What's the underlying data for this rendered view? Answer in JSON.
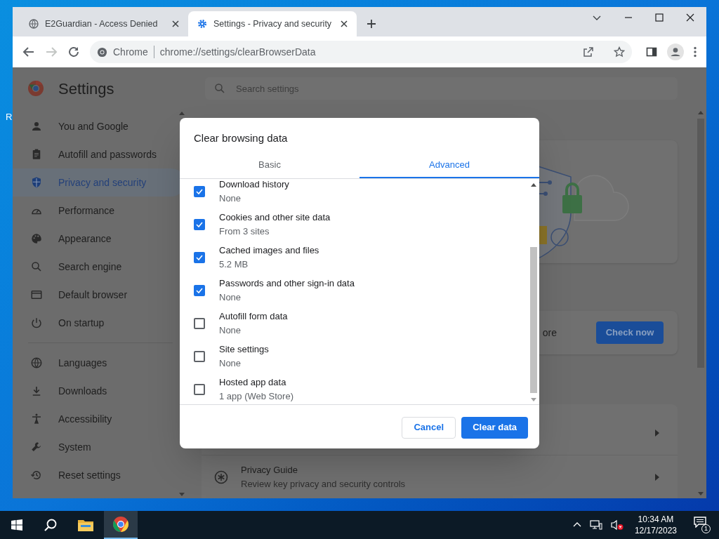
{
  "desktop": {
    "icon_label": "R"
  },
  "browser": {
    "tabs": [
      {
        "title": "E2Guardian - Access Denied",
        "selected": false
      },
      {
        "title": "Settings - Privacy and security",
        "selected": true
      }
    ],
    "forward_disabled": true,
    "omnibox": {
      "chip": "Chrome",
      "url": "chrome://settings/clearBrowserData"
    }
  },
  "settings": {
    "title": "Settings",
    "search": {
      "placeholder": "Search settings"
    },
    "nav_groups": [
      [
        {
          "label": "You and Google",
          "selected": false
        },
        {
          "label": "Autofill and passwords",
          "selected": false
        },
        {
          "label": "Privacy and security",
          "selected": true
        },
        {
          "label": "Performance",
          "selected": false
        },
        {
          "label": "Appearance",
          "selected": false
        },
        {
          "label": "Search engine",
          "selected": false
        },
        {
          "label": "Default browser",
          "selected": false
        },
        {
          "label": "On startup",
          "selected": false
        }
      ],
      [
        {
          "label": "Languages",
          "selected": false
        },
        {
          "label": "Downloads",
          "selected": false
        },
        {
          "label": "Accessibility",
          "selected": false
        },
        {
          "label": "System",
          "selected": false
        },
        {
          "label": "Reset settings",
          "selected": false
        }
      ]
    ],
    "safety_check": {
      "partial_text": "ore",
      "button": "Check now"
    },
    "rows": [
      {
        "kind": "covered"
      },
      {
        "kind": "item",
        "title": "Privacy Guide",
        "subtitle": "Review key privacy and security controls"
      }
    ]
  },
  "dialog": {
    "title": "Clear browsing data",
    "tabs": [
      {
        "label": "Basic",
        "selected": false
      },
      {
        "label": "Advanced",
        "selected": true
      }
    ],
    "items": [
      {
        "label": "Download history",
        "detail": "None",
        "checked": true
      },
      {
        "label": "Cookies and other site data",
        "detail": "From 3 sites",
        "checked": true
      },
      {
        "label": "Cached images and files",
        "detail": "5.2 MB",
        "checked": true
      },
      {
        "label": "Passwords and other sign-in data",
        "detail": "None",
        "checked": true
      },
      {
        "label": "Autofill form data",
        "detail": "None",
        "checked": false
      },
      {
        "label": "Site settings",
        "detail": "None",
        "checked": false
      },
      {
        "label": "Hosted app data",
        "detail": "1 app (Web Store)",
        "checked": false
      }
    ],
    "cancel": "Cancel",
    "confirm": "Clear data"
  },
  "taskbar": {
    "time": "10:34 AM",
    "date": "12/17/2023",
    "notifications": "1"
  }
}
